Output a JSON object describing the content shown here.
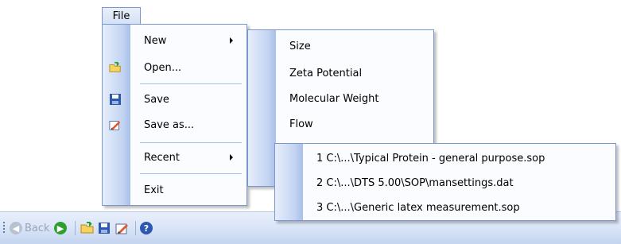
{
  "menubar": {
    "file_label": "File"
  },
  "file_menu": {
    "items": [
      {
        "label": "New"
      },
      {
        "label": "Open..."
      },
      {
        "label": "Save"
      },
      {
        "label": "Save as..."
      },
      {
        "label": "Recent"
      },
      {
        "label": "Exit"
      }
    ]
  },
  "new_submenu": {
    "items": [
      {
        "label": "Size"
      },
      {
        "label": "Zeta Potential"
      },
      {
        "label": "Molecular Weight"
      },
      {
        "label": "Flow"
      }
    ]
  },
  "recent_submenu": {
    "items": [
      {
        "label": "1 C:\\...\\Typical Protein - general purpose.sop"
      },
      {
        "label": "2 C:\\...\\DTS 5.00\\SOP\\mansettings.dat"
      },
      {
        "label": "3 C:\\...\\Generic latex measurement.sop"
      }
    ]
  },
  "toolbar": {
    "back_label": "Back"
  },
  "colors": {
    "accent": "#7b98cc",
    "gutter": "#c4d5f2",
    "toolbar": "#dbe6f8"
  }
}
